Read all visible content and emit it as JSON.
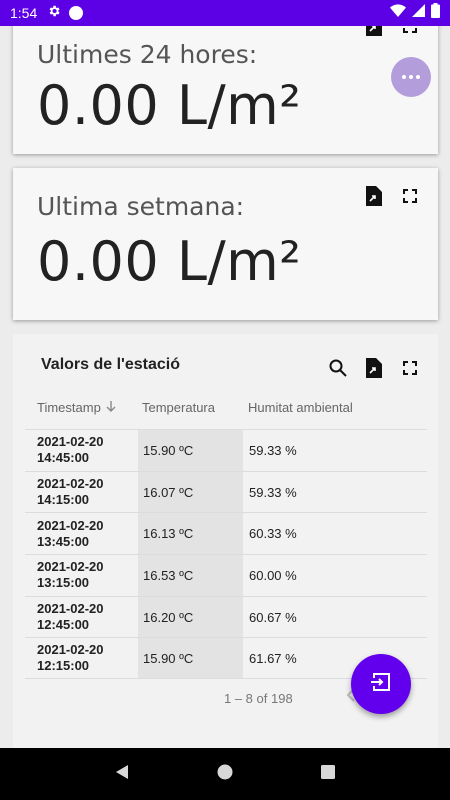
{
  "status_bar": {
    "time": "1:54"
  },
  "cards": [
    {
      "title": "Ultimes 24 hores:",
      "value": "0.00 L/m²"
    },
    {
      "title": "Ultima setmana:",
      "value": "0.00 L/m²"
    }
  ],
  "table": {
    "title": "Valors de l'estació",
    "columns": {
      "timestamp": "Timestamp",
      "temperature": "Temperatura",
      "humidity": "Humitat ambiental"
    },
    "rows": [
      {
        "date": "2021-02-20",
        "time": "14:45:00",
        "temp": "15.90 ºC",
        "hum": "59.33 %"
      },
      {
        "date": "2021-02-20",
        "time": "14:15:00",
        "temp": "16.07 ºC",
        "hum": "59.33 %"
      },
      {
        "date": "2021-02-20",
        "time": "13:45:00",
        "temp": "16.13 ºC",
        "hum": "60.33 %"
      },
      {
        "date": "2021-02-20",
        "time": "13:15:00",
        "temp": "16.53 ºC",
        "hum": "60.00 %"
      },
      {
        "date": "2021-02-20",
        "time": "12:45:00",
        "temp": "16.20 ºC",
        "hum": "60.67 %"
      },
      {
        "date": "2021-02-20",
        "time": "12:15:00",
        "temp": "15.90 ºC",
        "hum": "61.67 %"
      }
    ],
    "pagination": "1 – 8 of 198"
  },
  "colors": {
    "status_bar": "#5c00e6",
    "fab": "#6200ee",
    "fab_secondary": "#b39ddb"
  }
}
